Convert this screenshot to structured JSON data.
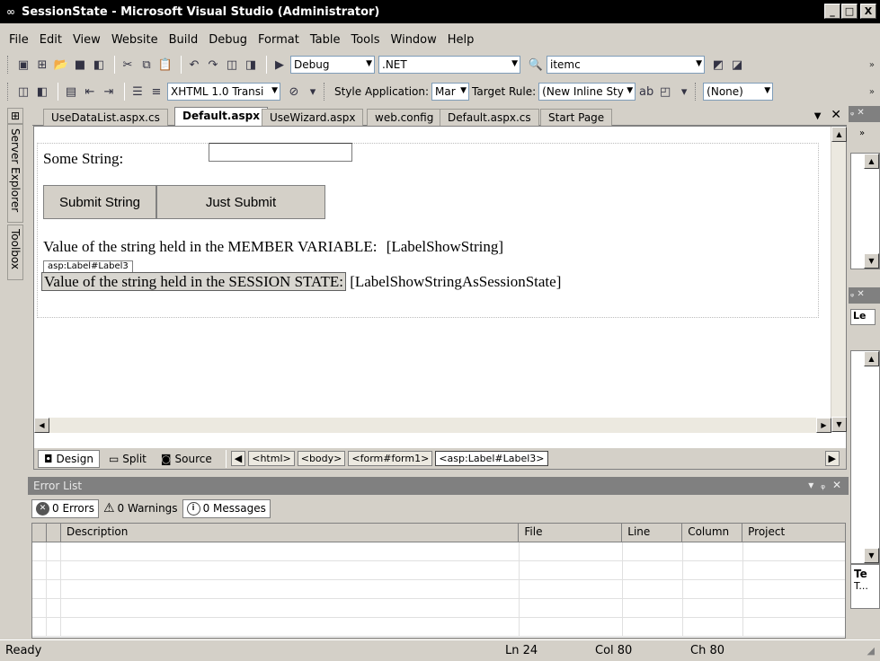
{
  "window": {
    "title": "SessionState - Microsoft Visual Studio (Administrator)",
    "minimize": "_",
    "maximize": "□",
    "close": "X"
  },
  "menu": [
    "File",
    "Edit",
    "View",
    "Website",
    "Build",
    "Debug",
    "Format",
    "Table",
    "Tools",
    "Window",
    "Help"
  ],
  "toolbar1": {
    "config": "Debug",
    "platform": ".NET",
    "find": "itemc"
  },
  "toolbar2": {
    "doctype": "XHTML 1.0 Transi",
    "style_app_label": "Style Application:",
    "style_app_value": "Mar",
    "target_rule_label": "Target Rule:",
    "target_rule_value": "(New Inline Sty",
    "class_value": "(None)"
  },
  "side_tabs": [
    "Server Explorer",
    "Toolbox"
  ],
  "doc_tabs": [
    "UseDataList.aspx.cs",
    "Default.aspx",
    "UseWizard.aspx",
    "web.config",
    "Default.aspx.cs",
    "Start Page"
  ],
  "active_tab": "Default.aspx",
  "design": {
    "some_string_label": "Some String:",
    "input_value": "",
    "submit_string": "Submit String",
    "just_submit": "Just Submit",
    "member_label": "Value of the string held in the MEMBER VARIABLE:",
    "member_value": "[LabelShowString]",
    "selected_tag": "asp:Label#Label3",
    "session_label": "Value of the string held in the SESSION STATE:",
    "session_value": "[LabelShowStringAsSessionState]"
  },
  "view_modes": [
    "Design",
    "Split",
    "Source"
  ],
  "active_view": "Design",
  "breadcrumbs": [
    "<html>",
    "<body>",
    "<form#form1>",
    "<asp:Label#Label3>"
  ],
  "error_list": {
    "title": "Error List",
    "errors": "0 Errors",
    "warnings": "0 Warnings",
    "messages": "0 Messages",
    "columns": [
      "Description",
      "File",
      "Line",
      "Column",
      "Project"
    ]
  },
  "right_panel": {
    "combo": "Le",
    "bottom_title": "Te",
    "bottom_sub": "T..."
  },
  "status": {
    "text": "Ready",
    "ln": "Ln 24",
    "col": "Col 80",
    "ch": "Ch 80"
  },
  "colors": {
    "title_bg": "#000000",
    "chrome": "#d4d0c8",
    "panel_title": "#808080"
  }
}
